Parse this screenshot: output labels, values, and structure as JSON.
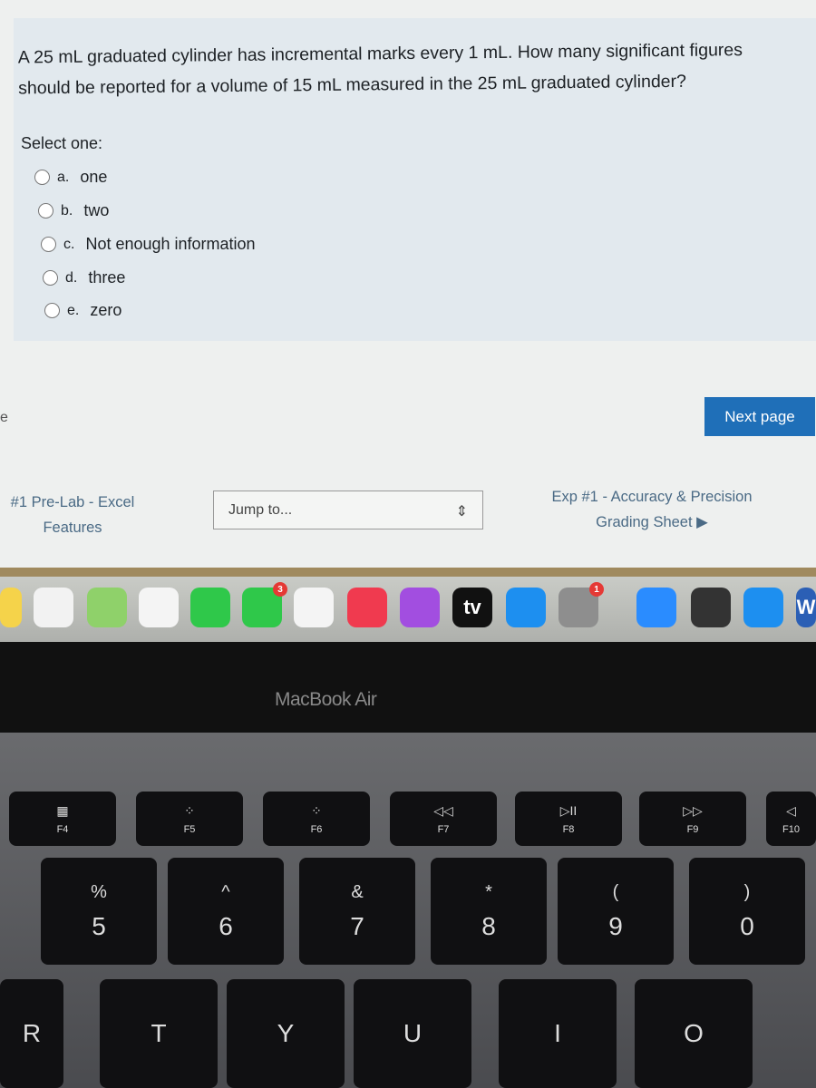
{
  "question": {
    "text": "A 25 mL graduated cylinder has incremental marks every 1 mL. How many significant figures should be reported for a volume of 15 mL measured in the 25 mL graduated cylinder?",
    "prompt": "Select one:",
    "options": [
      {
        "letter": "a.",
        "label": "one"
      },
      {
        "letter": "b.",
        "label": "two"
      },
      {
        "letter": "c.",
        "label": "Not enough information"
      },
      {
        "letter": "d.",
        "label": "three"
      },
      {
        "letter": "e.",
        "label": "zero"
      }
    ]
  },
  "nav": {
    "next_page": "Next page",
    "prev_link_line1": "#1 Pre-Lab - Excel",
    "prev_link_line2": "Features",
    "jump_to": "Jump to...",
    "next_link_line1": "Exp #1 - Accuracy & Precision",
    "next_link_line2": "Grading Sheet ▶"
  },
  "dock": {
    "apps": [
      {
        "icon": "notes-icon",
        "color": "#f5d34a"
      },
      {
        "icon": "reminders-icon",
        "color": "#f2f2f2"
      },
      {
        "icon": "maps-icon",
        "color": "#8fd16a"
      },
      {
        "icon": "photos-icon",
        "color": "#f4f4f4"
      },
      {
        "icon": "messages-icon",
        "color": "#2fc84a"
      },
      {
        "icon": "facetime-icon",
        "color": "#2fc84a",
        "badge": "3"
      },
      {
        "icon": "news-icon",
        "color": "#f4f4f4"
      },
      {
        "icon": "music-icon",
        "color": "#f03a4f"
      },
      {
        "icon": "podcasts-icon",
        "color": "#a24ee0"
      },
      {
        "icon": "apple-tv-icon",
        "color": "#111111",
        "label": "tv"
      },
      {
        "icon": "app-store-icon",
        "color": "#1d8ff0"
      },
      {
        "icon": "system-preferences-icon",
        "color": "#8e8e8e",
        "badge": "1"
      },
      {
        "icon": "zoom-icon",
        "color": "#2a8cff"
      },
      {
        "icon": "piano-icon",
        "color": "#333333"
      },
      {
        "icon": "bluetooth-icon",
        "color": "#1d8ff0"
      },
      {
        "icon": "word-icon",
        "color": "#2b5fb5",
        "label": "W"
      }
    ]
  },
  "laptop": {
    "brand": "MacBook Air"
  },
  "keyboard": {
    "fn": [
      {
        "sym": "▦",
        "label": "F4"
      },
      {
        "sym": "⁘",
        "label": "F5"
      },
      {
        "sym": "⁘",
        "label": "F6"
      },
      {
        "sym": "◁◁",
        "label": "F7"
      },
      {
        "sym": "▷II",
        "label": "F8"
      },
      {
        "sym": "▷▷",
        "label": "F9"
      },
      {
        "sym": "◁",
        "label": "F10"
      }
    ],
    "num": [
      {
        "top": "%",
        "bot": "5"
      },
      {
        "top": "^",
        "bot": "6"
      },
      {
        "top": "&",
        "bot": "7"
      },
      {
        "top": "*",
        "bot": "8"
      },
      {
        "top": "(",
        "bot": "9"
      },
      {
        "top": ")",
        "bot": "0"
      }
    ],
    "letters": [
      "R",
      "T",
      "Y",
      "U",
      "I",
      "O"
    ]
  }
}
